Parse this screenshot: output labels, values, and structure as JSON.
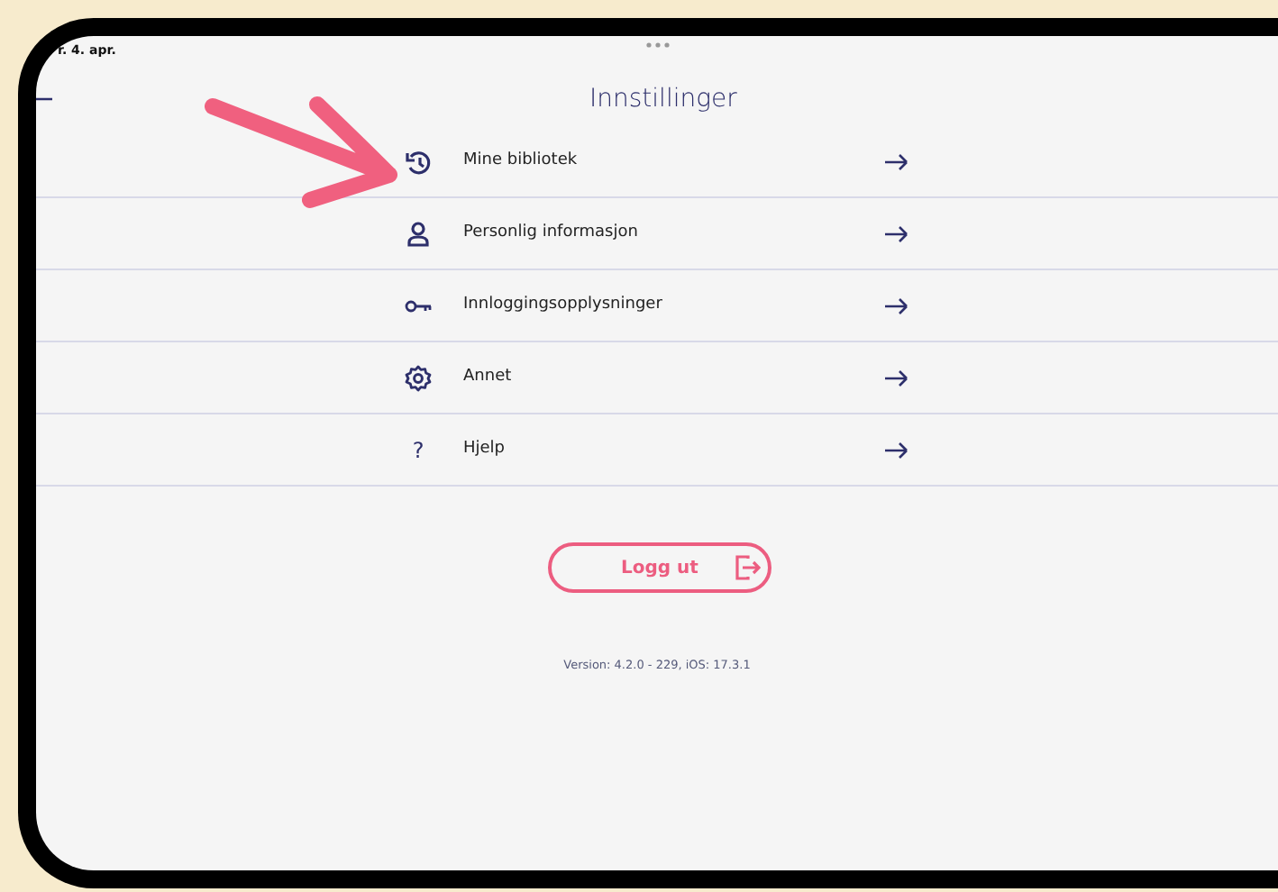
{
  "status_bar": {
    "date": "r. 4. apr."
  },
  "header": {
    "title": "Innstillinger"
  },
  "menu": [
    {
      "label": "Mine bibliotek"
    },
    {
      "label": "Personlig informasjon"
    },
    {
      "label": "Innloggingsopplysninger"
    },
    {
      "label": "Annet"
    },
    {
      "label": "Hjelp",
      "glyph": "?"
    }
  ],
  "logout_button": {
    "label": "Logg ut"
  },
  "version": "Version: 4.2.0 - 229, iOS: 17.3.1"
}
